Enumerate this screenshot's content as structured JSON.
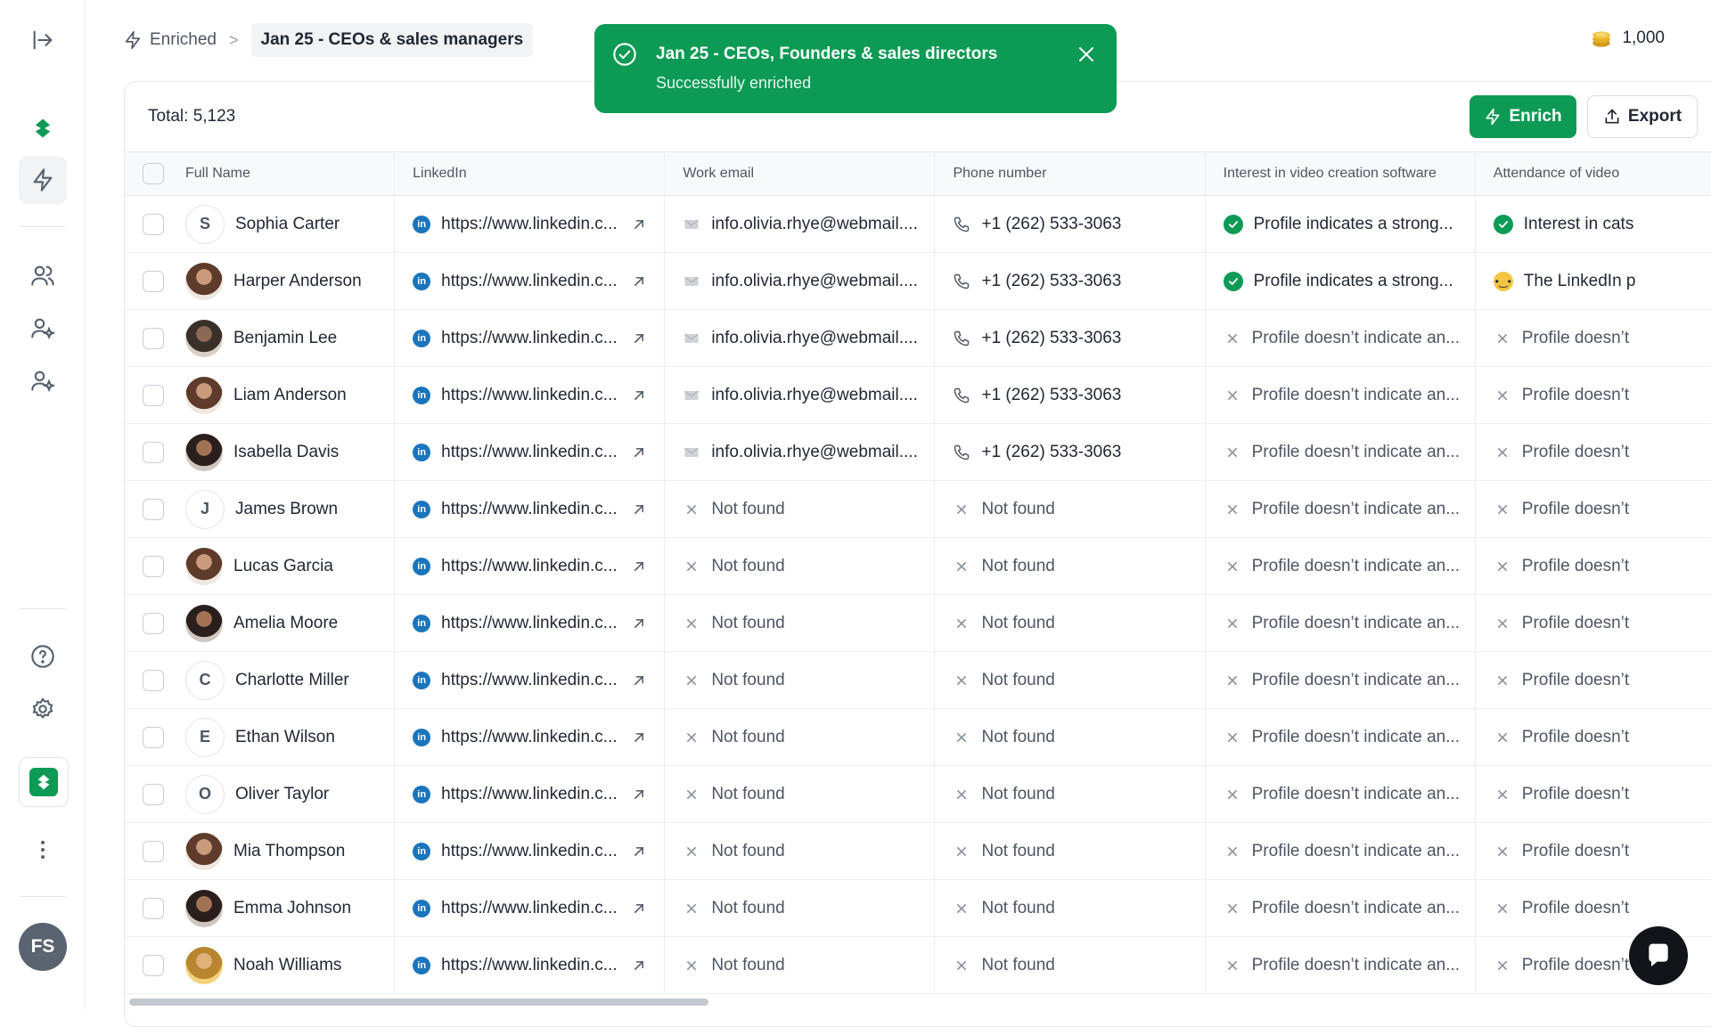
{
  "header": {
    "breadcrumb_root": "Enriched",
    "breadcrumb_separator": ">",
    "breadcrumb_current": "Jan 25 - CEOs & sales managers",
    "credits": "1,000"
  },
  "toast": {
    "title": "Jan 25 - CEOs, Founders & sales directors",
    "message": "Successfully enriched"
  },
  "toolbar": {
    "total_label": "Total: 5,123",
    "enrich_label": "Enrich",
    "export_label": "Export"
  },
  "sidebar": {
    "user_initials": "FS",
    "icons": [
      "collapse-icon",
      "brand-logo-icon",
      "enrich-bolt-icon",
      "users-icon",
      "user-sparkle-icon",
      "user-sparkle-icon",
      "help-icon",
      "gear-icon",
      "brand-app-icon",
      "more-vertical-icon"
    ]
  },
  "table": {
    "columns": [
      "Full Name",
      "LinkedIn",
      "Work email",
      "Phone number",
      "Interest in video creation software",
      "Attendance of video"
    ],
    "rows": [
      {
        "name": "Sophia Carter",
        "avatar": "S",
        "avatar_type": "initial",
        "linkedin": "https://www.linkedin.c...",
        "email": "info.olivia.rhye@webmail....",
        "email_found": true,
        "phone": "+1 (262) 533-3063",
        "phone_found": true,
        "interest": "Profile indicates a strong...",
        "interest_state": "positive",
        "attendance": "Interest in cats",
        "attendance_state": "positive"
      },
      {
        "name": "Harper Anderson",
        "avatar": "",
        "avatar_type": "photo2",
        "linkedin": "https://www.linkedin.c...",
        "email": "info.olivia.rhye@webmail....",
        "email_found": true,
        "phone": "+1 (262) 533-3063",
        "phone_found": true,
        "interest": "Profile indicates a strong...",
        "interest_state": "positive",
        "attendance": "The LinkedIn p",
        "attendance_state": "thinking"
      },
      {
        "name": "Benjamin Lee",
        "avatar": "",
        "avatar_type": "photo",
        "linkedin": "https://www.linkedin.c...",
        "email": "info.olivia.rhye@webmail....",
        "email_found": true,
        "phone": "+1 (262) 533-3063",
        "phone_found": true,
        "interest": "Profile doesn’t indicate an...",
        "interest_state": "negative",
        "attendance": "Profile doesn’t",
        "attendance_state": "negative"
      },
      {
        "name": "Liam Anderson",
        "avatar": "",
        "avatar_type": "photo2",
        "linkedin": "https://www.linkedin.c...",
        "email": "info.olivia.rhye@webmail....",
        "email_found": true,
        "phone": "+1 (262) 533-3063",
        "phone_found": true,
        "interest": "Profile doesn’t indicate an...",
        "interest_state": "negative",
        "attendance": "Profile doesn’t",
        "attendance_state": "negative"
      },
      {
        "name": "Isabella Davis",
        "avatar": "",
        "avatar_type": "photo3",
        "linkedin": "https://www.linkedin.c...",
        "email": "info.olivia.rhye@webmail....",
        "email_found": true,
        "phone": "+1 (262) 533-3063",
        "phone_found": true,
        "interest": "Profile doesn’t indicate an...",
        "interest_state": "negative",
        "attendance": "Profile doesn’t",
        "attendance_state": "negative"
      },
      {
        "name": "James Brown",
        "avatar": "J",
        "avatar_type": "initial",
        "linkedin": "https://www.linkedin.c...",
        "email": "Not found",
        "email_found": false,
        "phone": "Not found",
        "phone_found": false,
        "interest": "Profile doesn’t indicate an...",
        "interest_state": "negative",
        "attendance": "Profile doesn’t",
        "attendance_state": "negative"
      },
      {
        "name": "Lucas Garcia",
        "avatar": "",
        "avatar_type": "photo2",
        "linkedin": "https://www.linkedin.c...",
        "email": "Not found",
        "email_found": false,
        "phone": "Not found",
        "phone_found": false,
        "interest": "Profile doesn’t indicate an...",
        "interest_state": "negative",
        "attendance": "Profile doesn’t",
        "attendance_state": "negative"
      },
      {
        "name": "Amelia Moore",
        "avatar": "",
        "avatar_type": "photo3",
        "linkedin": "https://www.linkedin.c...",
        "email": "Not found",
        "email_found": false,
        "phone": "Not found",
        "phone_found": false,
        "interest": "Profile doesn’t indicate an...",
        "interest_state": "negative",
        "attendance": "Profile doesn’t",
        "attendance_state": "negative"
      },
      {
        "name": "Charlotte Miller",
        "avatar": "C",
        "avatar_type": "initial",
        "linkedin": "https://www.linkedin.c...",
        "email": "Not found",
        "email_found": false,
        "phone": "Not found",
        "phone_found": false,
        "interest": "Profile doesn’t indicate an...",
        "interest_state": "negative",
        "attendance": "Profile doesn’t",
        "attendance_state": "negative"
      },
      {
        "name": "Ethan Wilson",
        "avatar": "E",
        "avatar_type": "initial",
        "linkedin": "https://www.linkedin.c...",
        "email": "Not found",
        "email_found": false,
        "phone": "Not found",
        "phone_found": false,
        "interest": "Profile doesn’t indicate an...",
        "interest_state": "negative",
        "attendance": "Profile doesn’t",
        "attendance_state": "negative"
      },
      {
        "name": "Oliver Taylor",
        "avatar": "O",
        "avatar_type": "initial",
        "linkedin": "https://www.linkedin.c...",
        "email": "Not found",
        "email_found": false,
        "phone": "Not found",
        "phone_found": false,
        "interest": "Profile doesn’t indicate an...",
        "interest_state": "negative",
        "attendance": "Profile doesn’t",
        "attendance_state": "negative"
      },
      {
        "name": "Mia Thompson",
        "avatar": "",
        "avatar_type": "photo2",
        "linkedin": "https://www.linkedin.c...",
        "email": "Not found",
        "email_found": false,
        "phone": "Not found",
        "phone_found": false,
        "interest": "Profile doesn’t indicate an...",
        "interest_state": "negative",
        "attendance": "Profile doesn’t",
        "attendance_state": "negative"
      },
      {
        "name": "Emma Johnson",
        "avatar": "",
        "avatar_type": "photo3",
        "linkedin": "https://www.linkedin.c...",
        "email": "Not found",
        "email_found": false,
        "phone": "Not found",
        "phone_found": false,
        "interest": "Profile doesn’t indicate an...",
        "interest_state": "negative",
        "attendance": "Profile doesn’t",
        "attendance_state": "negative"
      },
      {
        "name": "Noah Williams",
        "avatar": "",
        "avatar_type": "photo4",
        "linkedin": "https://www.linkedin.c...",
        "email": "Not found",
        "email_found": false,
        "phone": "Not found",
        "phone_found": false,
        "interest": "Profile doesn’t indicate an...",
        "interest_state": "negative",
        "attendance": "Profile doesn’t",
        "attendance_state": "negative"
      }
    ]
  },
  "colors": {
    "brand_green": "#0d9a55",
    "linkedin_blue": "#1b75bb"
  }
}
